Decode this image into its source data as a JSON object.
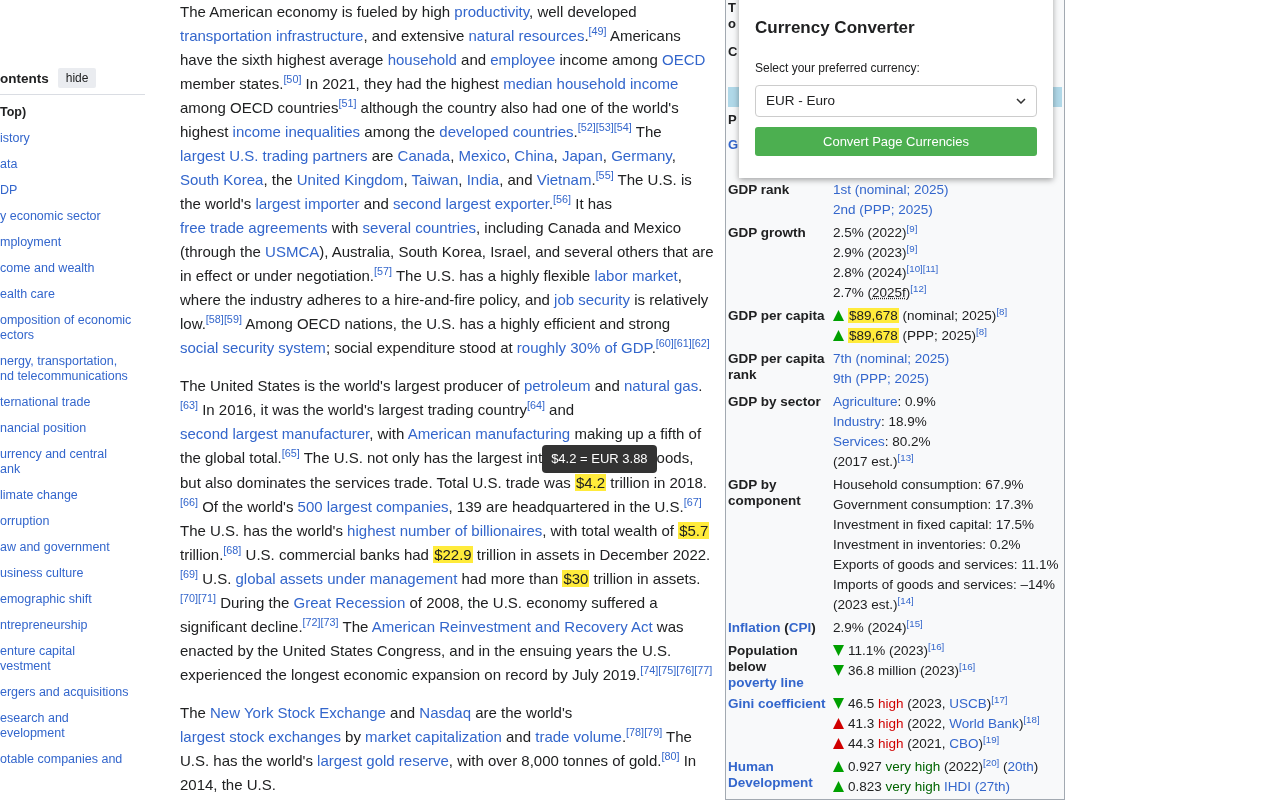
{
  "toc": {
    "heading": "ontents",
    "hide_button": "hide",
    "items": [
      {
        "text": "Top)",
        "kind": "current"
      },
      {
        "text": "istory",
        "kind": "link"
      },
      {
        "text": "ata",
        "kind": "link"
      },
      {
        "text": "DP",
        "kind": "link"
      },
      {
        "text": "y economic sector",
        "kind": "link"
      },
      {
        "text": "mployment",
        "kind": "link"
      },
      {
        "text": "come and wealth",
        "kind": "link"
      },
      {
        "text": "ealth care",
        "kind": "link"
      },
      {
        "text": "omposition of economic\nectors",
        "kind": "link"
      },
      {
        "text": "nergy, transportation,\nnd telecommunications",
        "kind": "link"
      },
      {
        "text": "ternational trade",
        "kind": "link"
      },
      {
        "text": "nancial position",
        "kind": "link"
      },
      {
        "text": "urrency and central\nank",
        "kind": "link"
      },
      {
        "text": "limate change",
        "kind": "link"
      },
      {
        "text": "orruption",
        "kind": "link"
      },
      {
        "text": "aw and government",
        "kind": "link"
      },
      {
        "text": "usiness culture",
        "kind": "link"
      },
      {
        "text": "emographic shift",
        "kind": "link"
      },
      {
        "text": "ntrepreneurship",
        "kind": "link"
      },
      {
        "text": "enture capital\nvestment",
        "kind": "link"
      },
      {
        "text": "ergers and acquisitions",
        "kind": "link"
      },
      {
        "text": "esearch and\nevelopment",
        "kind": "link"
      },
      {
        "text": "otable companies and",
        "kind": "link"
      }
    ]
  },
  "article": {
    "paragraphs": [
      [
        {
          "kind": "text",
          "text": "The American economy is fueled by high "
        },
        {
          "kind": "link",
          "text": "productivity"
        },
        {
          "kind": "text",
          "text": ", well developed "
        },
        {
          "kind": "link",
          "text": "transportation infrastructure"
        },
        {
          "kind": "text",
          "text": ", and extensive "
        },
        {
          "kind": "link",
          "text": "natural resources"
        },
        {
          "kind": "text",
          "text": "."
        },
        {
          "kind": "ref",
          "text": "[49]"
        },
        {
          "kind": "text",
          "text": " Americans have the sixth highest average "
        },
        {
          "kind": "link",
          "text": "household"
        },
        {
          "kind": "text",
          "text": " and "
        },
        {
          "kind": "link",
          "text": "employee"
        },
        {
          "kind": "text",
          "text": " income among "
        },
        {
          "kind": "link",
          "text": "OECD"
        },
        {
          "kind": "text",
          "text": " member states."
        },
        {
          "kind": "ref",
          "text": "[50]"
        },
        {
          "kind": "text",
          "text": " In 2021, they had the highest "
        },
        {
          "kind": "link",
          "text": "median household income"
        },
        {
          "kind": "text",
          "text": " among OECD countries"
        },
        {
          "kind": "ref",
          "text": "[51]"
        },
        {
          "kind": "text",
          "text": " although the country also had one of the world's highest "
        },
        {
          "kind": "link",
          "text": "income inequalities"
        },
        {
          "kind": "text",
          "text": " among the "
        },
        {
          "kind": "link",
          "text": "developed countries"
        },
        {
          "kind": "text",
          "text": "."
        },
        {
          "kind": "ref",
          "text": "[52]"
        },
        {
          "kind": "ref",
          "text": "[53]"
        },
        {
          "kind": "ref",
          "text": "[54]"
        },
        {
          "kind": "text",
          "text": " The "
        },
        {
          "kind": "link",
          "text": "largest U.S. trading partners"
        },
        {
          "kind": "text",
          "text": " are "
        },
        {
          "kind": "link",
          "text": "Canada"
        },
        {
          "kind": "text",
          "text": ", "
        },
        {
          "kind": "link",
          "text": "Mexico"
        },
        {
          "kind": "text",
          "text": ", "
        },
        {
          "kind": "link",
          "text": "China"
        },
        {
          "kind": "text",
          "text": ", "
        },
        {
          "kind": "link",
          "text": "Japan"
        },
        {
          "kind": "text",
          "text": ", "
        },
        {
          "kind": "link",
          "text": "Germany"
        },
        {
          "kind": "text",
          "text": ", "
        },
        {
          "kind": "link",
          "text": "South Korea"
        },
        {
          "kind": "text",
          "text": ", the "
        },
        {
          "kind": "link",
          "text": "United Kingdom"
        },
        {
          "kind": "text",
          "text": ", "
        },
        {
          "kind": "link",
          "text": "Taiwan"
        },
        {
          "kind": "text",
          "text": ", "
        },
        {
          "kind": "link",
          "text": "India"
        },
        {
          "kind": "text",
          "text": ", and "
        },
        {
          "kind": "link",
          "text": "Vietnam"
        },
        {
          "kind": "text",
          "text": "."
        },
        {
          "kind": "ref",
          "text": "[55]"
        },
        {
          "kind": "text",
          "text": " The U.S. is the world's "
        },
        {
          "kind": "link",
          "text": "largest importer"
        },
        {
          "kind": "text",
          "text": " and "
        },
        {
          "kind": "link",
          "text": "second largest exporter"
        },
        {
          "kind": "text",
          "text": "."
        },
        {
          "kind": "ref",
          "text": "[56]"
        },
        {
          "kind": "text",
          "text": " It has "
        },
        {
          "kind": "link",
          "text": "free trade agreements"
        },
        {
          "kind": "text",
          "text": " with "
        },
        {
          "kind": "link",
          "text": "several countries"
        },
        {
          "kind": "text",
          "text": ", including Canada and Mexico (through the "
        },
        {
          "kind": "link",
          "text": "USMCA"
        },
        {
          "kind": "text",
          "text": "), Australia, South Korea, Israel, and several others that are in effect or under negotiation."
        },
        {
          "kind": "ref",
          "text": "[57]"
        },
        {
          "kind": "text",
          "text": " The U.S. has a highly flexible "
        },
        {
          "kind": "link",
          "text": "labor market"
        },
        {
          "kind": "text",
          "text": ", where the industry adheres to a hire-and-fire policy, and "
        },
        {
          "kind": "link",
          "text": "job security"
        },
        {
          "kind": "text",
          "text": " is relatively low."
        },
        {
          "kind": "ref",
          "text": "[58]"
        },
        {
          "kind": "ref",
          "text": "[59]"
        },
        {
          "kind": "text",
          "text": " Among OECD nations, the U.S. has a highly efficient and strong "
        },
        {
          "kind": "link",
          "text": "social security system"
        },
        {
          "kind": "text",
          "text": "; social expenditure stood at "
        },
        {
          "kind": "link",
          "text": "roughly 30% of GDP"
        },
        {
          "kind": "text",
          "text": "."
        },
        {
          "kind": "ref",
          "text": "[60]"
        },
        {
          "kind": "ref",
          "text": "[61]"
        },
        {
          "kind": "ref",
          "text": "[62]"
        }
      ],
      [
        {
          "kind": "text",
          "text": "The United States is the world's largest producer of "
        },
        {
          "kind": "link",
          "text": "petroleum"
        },
        {
          "kind": "text",
          "text": " and "
        },
        {
          "kind": "link",
          "text": "natural gas"
        },
        {
          "kind": "text",
          "text": "."
        },
        {
          "kind": "ref",
          "text": "[63]"
        },
        {
          "kind": "text",
          "text": " In 2016, it was the world's largest trading country"
        },
        {
          "kind": "ref",
          "text": "[64]"
        },
        {
          "kind": "text",
          "text": " and "
        },
        {
          "kind": "link",
          "text": "second largest manufacturer"
        },
        {
          "kind": "text",
          "text": ", with "
        },
        {
          "kind": "link",
          "text": "American manufacturing"
        },
        {
          "kind": "text",
          "text": " making up a fifth of the global total."
        },
        {
          "kind": "ref",
          "text": "[65]"
        },
        {
          "kind": "text",
          "text": " The U.S. not only has the largest int"
        },
        {
          "kind": "tooltip",
          "text": "$4.2 = EUR 3.88"
        },
        {
          "kind": "text",
          "text": "oods, but also dominates the services trade. Total U.S. trade was "
        },
        {
          "kind": "money",
          "text": "$4.2"
        },
        {
          "kind": "text",
          "text": " trillion in 2018."
        },
        {
          "kind": "ref",
          "text": "[66]"
        },
        {
          "kind": "text",
          "text": " Of the world's "
        },
        {
          "kind": "link",
          "text": "500 largest companies"
        },
        {
          "kind": "text",
          "text": ", 139 are headquartered in the U.S."
        },
        {
          "kind": "ref",
          "text": "[67]"
        },
        {
          "kind": "text",
          "text": " The U.S. has the world's "
        },
        {
          "kind": "link",
          "text": "highest number of billionaires"
        },
        {
          "kind": "text",
          "text": ", with total wealth of "
        },
        {
          "kind": "money",
          "text": "$5.7"
        },
        {
          "kind": "text",
          "text": " trillion."
        },
        {
          "kind": "ref",
          "text": "[68]"
        },
        {
          "kind": "text",
          "text": " U.S. commercial banks had "
        },
        {
          "kind": "money",
          "text": "$22.9"
        },
        {
          "kind": "text",
          "text": " trillion in assets in December 2022."
        },
        {
          "kind": "ref",
          "text": "[69]"
        },
        {
          "kind": "text",
          "text": " U.S. "
        },
        {
          "kind": "link",
          "text": "global assets under management"
        },
        {
          "kind": "text",
          "text": " had more than "
        },
        {
          "kind": "money",
          "text": "$30"
        },
        {
          "kind": "text",
          "text": " trillion in assets."
        },
        {
          "kind": "ref",
          "text": "[70]"
        },
        {
          "kind": "ref",
          "text": "[71]"
        },
        {
          "kind": "text",
          "text": " During the "
        },
        {
          "kind": "link",
          "text": "Great Recession"
        },
        {
          "kind": "text",
          "text": " of 2008, the U.S. economy suffered a significant decline."
        },
        {
          "kind": "ref",
          "text": "[72]"
        },
        {
          "kind": "ref",
          "text": "[73]"
        },
        {
          "kind": "text",
          "text": " The "
        },
        {
          "kind": "link",
          "text": "American Reinvestment and Recovery Act"
        },
        {
          "kind": "text",
          "text": " was enacted by the United States Congress, and in the ensuing years the U.S. experienced the longest economic expansion on record by July 2019."
        },
        {
          "kind": "ref",
          "text": "[74]"
        },
        {
          "kind": "ref",
          "text": "[75]"
        },
        {
          "kind": "ref",
          "text": "[76]"
        },
        {
          "kind": "ref",
          "text": "[77]"
        }
      ],
      [
        {
          "kind": "text",
          "text": "The "
        },
        {
          "kind": "link",
          "text": "New York Stock Exchange"
        },
        {
          "kind": "text",
          "text": " and "
        },
        {
          "kind": "link",
          "text": "Nasdaq"
        },
        {
          "kind": "text",
          "text": " are the world's "
        },
        {
          "kind": "link",
          "text": "largest stock exchanges"
        },
        {
          "kind": "text",
          "text": " by "
        },
        {
          "kind": "link",
          "text": "market capitalization"
        },
        {
          "kind": "text",
          "text": " and "
        },
        {
          "kind": "link",
          "text": "trade volume"
        },
        {
          "kind": "text",
          "text": "."
        },
        {
          "kind": "ref",
          "text": "[78]"
        },
        {
          "kind": "ref",
          "text": "[79]"
        },
        {
          "kind": "text",
          "text": " The U.S. has the world's "
        },
        {
          "kind": "link",
          "text": "largest gold reserve"
        },
        {
          "kind": "text",
          "text": ", with over 8,000 tonnes of gold."
        },
        {
          "kind": "ref",
          "text": "[80]"
        },
        {
          "kind": "text",
          "text": " In 2014, the U.S."
        }
      ]
    ]
  },
  "infobox": {
    "covered_rows": [
      {
        "kind": "label",
        "text": "T"
      },
      {
        "kind": "label",
        "text": "o"
      },
      {
        "kind": "gap"
      },
      {
        "kind": "label",
        "text": "C"
      },
      {
        "kind": "gap"
      },
      {
        "kind": "band"
      },
      {
        "kind": "label",
        "text": "P"
      },
      {
        "kind": "link",
        "text": "G"
      }
    ],
    "rows": [
      {
        "label": [
          {
            "kind": "text",
            "text": "GDP rank"
          }
        ],
        "values": [
          [
            {
              "kind": "link",
              "text": "1st (nominal; 2025)"
            }
          ],
          [
            {
              "kind": "link",
              "text": "2nd (PPP; 2025)"
            }
          ]
        ]
      },
      {
        "label": [
          {
            "kind": "text",
            "text": "GDP growth"
          }
        ],
        "values": [
          [
            {
              "kind": "text",
              "text": "2.5% (2022)"
            },
            {
              "kind": "ref",
              "text": "[9]"
            }
          ],
          [
            {
              "kind": "text",
              "text": "2.9% (2023)"
            },
            {
              "kind": "ref",
              "text": "[9]"
            }
          ],
          [
            {
              "kind": "text",
              "text": "2.8% (2024)"
            },
            {
              "kind": "ref",
              "text": "[10]"
            },
            {
              "kind": "ref",
              "text": "[11]"
            }
          ],
          [
            {
              "kind": "text",
              "text": "2.7% ("
            },
            {
              "kind": "abbr",
              "text": "2025f"
            },
            {
              "kind": "text",
              "text": ")"
            },
            {
              "kind": "ref",
              "text": "[12]"
            }
          ]
        ]
      },
      {
        "label": [
          {
            "kind": "text",
            "text": "GDP per capita"
          }
        ],
        "values": [
          [
            {
              "kind": "up-good"
            },
            {
              "kind": "money",
              "text": "$89,678"
            },
            {
              "kind": "text",
              "text": " (nominal; 2025)"
            },
            {
              "kind": "ref",
              "text": "[8]"
            }
          ],
          [
            {
              "kind": "up-good"
            },
            {
              "kind": "money",
              "text": "$89,678"
            },
            {
              "kind": "text",
              "text": " (PPP; 2025)"
            },
            {
              "kind": "ref",
              "text": "[8]"
            }
          ]
        ]
      },
      {
        "label": [
          {
            "kind": "text",
            "text": "GDP per capita rank"
          }
        ],
        "values": [
          [
            {
              "kind": "link",
              "text": "7th (nominal; 2025)"
            }
          ],
          [
            {
              "kind": "link",
              "text": "9th (PPP; 2025)"
            }
          ]
        ]
      },
      {
        "label": [
          {
            "kind": "text",
            "text": "GDP by sector"
          }
        ],
        "values": [
          [
            {
              "kind": "link",
              "text": "Agriculture"
            },
            {
              "kind": "text",
              "text": ": 0.9%"
            }
          ],
          [
            {
              "kind": "link",
              "text": "Industry"
            },
            {
              "kind": "text",
              "text": ": 18.9%"
            }
          ],
          [
            {
              "kind": "link",
              "text": "Services"
            },
            {
              "kind": "text",
              "text": ": 80.2%"
            }
          ],
          [
            {
              "kind": "text",
              "text": "(2017 est.)"
            },
            {
              "kind": "ref",
              "text": "[13]"
            }
          ]
        ]
      },
      {
        "label": [
          {
            "kind": "text",
            "text": "GDP by component"
          }
        ],
        "values": [
          [
            {
              "kind": "text",
              "text": "Household consumption: 67.9%"
            }
          ],
          [
            {
              "kind": "text",
              "text": "Government consumption: 17.3%"
            }
          ],
          [
            {
              "kind": "text",
              "text": "Investment in fixed capital: 17.5%"
            }
          ],
          [
            {
              "kind": "text",
              "text": "Investment in inventories: 0.2%"
            }
          ],
          [
            {
              "kind": "text",
              "text": "Exports of goods and services: 11.1%"
            }
          ],
          [
            {
              "kind": "text",
              "text": "Imports of goods and services: –14%"
            }
          ],
          [
            {
              "kind": "text",
              "text": "(2023 est.)"
            },
            {
              "kind": "ref",
              "text": "[14]"
            }
          ]
        ]
      },
      {
        "label": [
          {
            "kind": "link",
            "text": "Inflation"
          },
          {
            "kind": "text",
            "text": " ("
          },
          {
            "kind": "link",
            "text": "CPI"
          },
          {
            "kind": "text",
            "text": ")"
          }
        ],
        "values": [
          [
            {
              "kind": "text",
              "text": "2.9% (2024)"
            },
            {
              "kind": "ref",
              "text": "[15]"
            }
          ]
        ]
      },
      {
        "label": [
          {
            "kind": "text",
            "text": "Population below "
          },
          {
            "kind": "link",
            "text": "poverty line"
          }
        ],
        "values": [
          [
            {
              "kind": "down-good"
            },
            {
              "kind": "text",
              "text": "11.1% (2023)"
            },
            {
              "kind": "ref",
              "text": "[16]"
            }
          ],
          [
            {
              "kind": "down-good"
            },
            {
              "kind": "text",
              "text": "36.8 million (2023)"
            },
            {
              "kind": "ref",
              "text": "[16]"
            }
          ]
        ]
      },
      {
        "label": [
          {
            "kind": "link",
            "text": "Gini coefficient"
          }
        ],
        "values": [
          [
            {
              "kind": "down-good"
            },
            {
              "kind": "text",
              "text": "46.5 "
            },
            {
              "kind": "bad",
              "text": "high"
            },
            {
              "kind": "text",
              "text": " (2023, "
            },
            {
              "kind": "link",
              "text": "USCB"
            },
            {
              "kind": "text",
              "text": ")"
            },
            {
              "kind": "ref",
              "text": "[17]"
            }
          ],
          [
            {
              "kind": "up-bad"
            },
            {
              "kind": "text",
              "text": "41.3 "
            },
            {
              "kind": "bad",
              "text": "high"
            },
            {
              "kind": "text",
              "text": " (2022, "
            },
            {
              "kind": "link",
              "text": "World Bank"
            },
            {
              "kind": "text",
              "text": ")"
            },
            {
              "kind": "ref",
              "text": "[18]"
            }
          ],
          [
            {
              "kind": "up-bad"
            },
            {
              "kind": "text",
              "text": "44.3 "
            },
            {
              "kind": "bad",
              "text": "high"
            },
            {
              "kind": "text",
              "text": " (2021, "
            },
            {
              "kind": "link",
              "text": "CBO"
            },
            {
              "kind": "text",
              "text": ")"
            },
            {
              "kind": "ref",
              "text": "[19]"
            }
          ]
        ]
      },
      {
        "label": [
          {
            "kind": "link",
            "text": "Human Development"
          }
        ],
        "values": [
          [
            {
              "kind": "up-good"
            },
            {
              "kind": "text",
              "text": "0.927 "
            },
            {
              "kind": "good",
              "text": "very high"
            },
            {
              "kind": "text",
              "text": " (2022)"
            },
            {
              "kind": "ref",
              "text": "[20]"
            },
            {
              "kind": "text",
              "text": " ("
            },
            {
              "kind": "link",
              "text": "20th"
            },
            {
              "kind": "text",
              "text": ")"
            }
          ],
          [
            {
              "kind": "up-good"
            },
            {
              "kind": "text",
              "text": "0.823 "
            },
            {
              "kind": "good",
              "text": "very high "
            },
            {
              "kind": "link",
              "text": "IHDI (27th)"
            }
          ]
        ]
      }
    ]
  },
  "converter": {
    "title": "Currency Converter",
    "prompt": "Select your preferred currency:",
    "currency": "EUR - Euro",
    "button": "Convert Page Currencies"
  }
}
